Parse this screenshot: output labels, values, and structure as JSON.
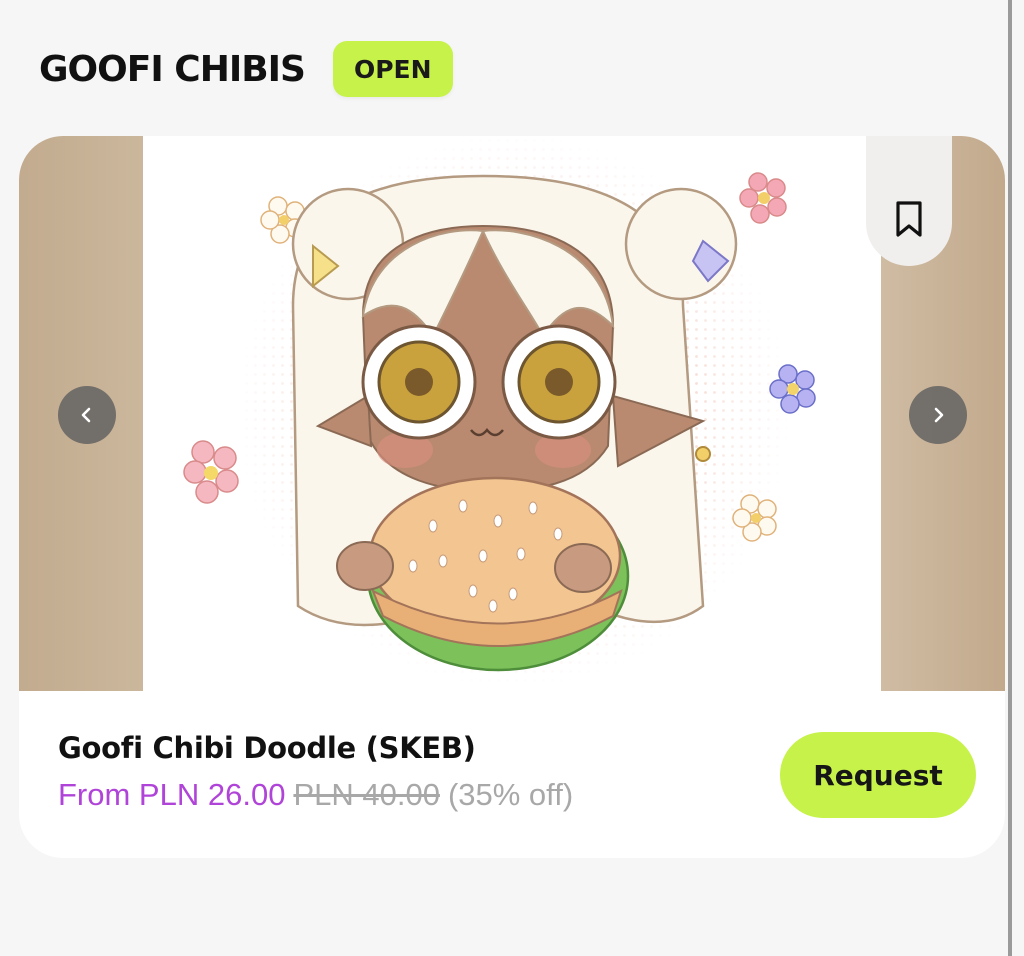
{
  "header": {
    "title": "GOOFI CHIBIS",
    "status_badge": "OPEN"
  },
  "gallery": {
    "image_alt": "Chibi illustration of a white-haired character holding a burger",
    "prev_icon": "chevron-left-icon",
    "next_icon": "chevron-right-icon",
    "bookmark_icon": "bookmark-icon"
  },
  "product": {
    "name": "Goofi Chibi Doodle (SKEB)",
    "price_from": "From PLN 26.00",
    "price_original": "PLN 40.00",
    "discount": "(35% off)",
    "request_label": "Request"
  },
  "colors": {
    "accent_green": "#c6f24a",
    "price_purple": "#b044d8",
    "side_tan": "#c6b095"
  }
}
